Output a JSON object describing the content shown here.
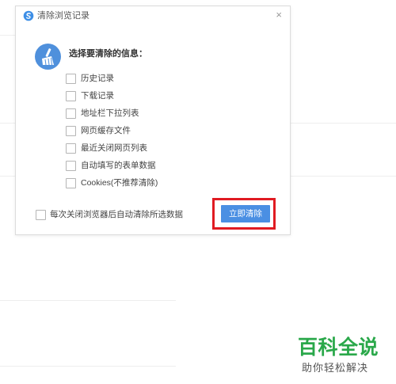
{
  "dialog": {
    "title": "清除浏览记录",
    "close_glyph": "×",
    "prompt": "选择要清除的信息：",
    "options": [
      {
        "label": "历史记录",
        "checked": false
      },
      {
        "label": "下载记录",
        "checked": false
      },
      {
        "label": "地址栏下拉列表",
        "checked": false
      },
      {
        "label": "网页缓存文件",
        "checked": false
      },
      {
        "label": "最近关闭网页列表",
        "checked": false
      },
      {
        "label": "自动填写的表单数据",
        "checked": false
      },
      {
        "label": "Cookies(不推荐清除)",
        "checked": false
      }
    ],
    "auto_clear_label": "每次关闭浏览器后自动清除所选数据",
    "auto_clear_checked": false,
    "clear_button_label": "立即清除"
  },
  "watermark": {
    "main": "百科全说",
    "sub": "助你轻松解决"
  },
  "colors": {
    "accent": "#4a8fe3",
    "highlight": "#e01b22",
    "watermark": "#2aa84a"
  },
  "icons": {
    "title_icon": "browser-logo-icon",
    "header_icon": "broom-icon"
  }
}
